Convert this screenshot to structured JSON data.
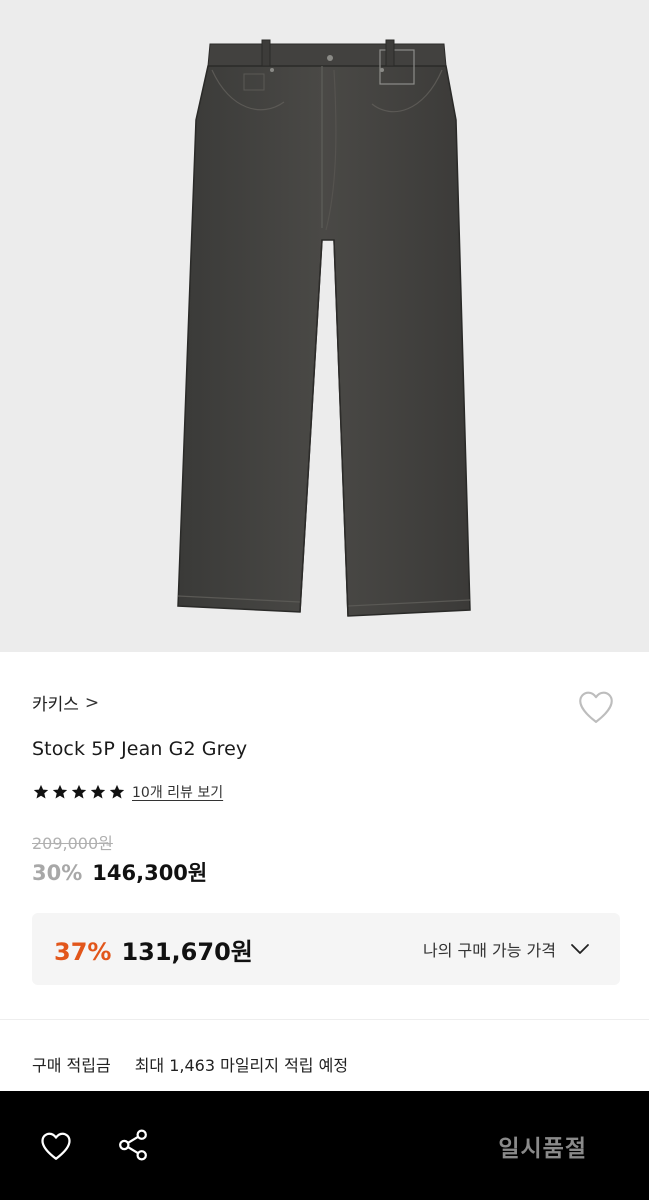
{
  "product": {
    "brand": "카키스",
    "brand_chevron": ">",
    "title": "Stock 5P Jean G2 Grey",
    "rating_stars": 5,
    "review_link": "10개 리뷰 보기",
    "original_price": "209,000원",
    "discount_rate": "30%",
    "sale_price": "146,300원",
    "image_icon": "jeans-photo"
  },
  "my_price": {
    "discount_rate": "37%",
    "amount": "131,670원",
    "label": "나의 구매 가능 가격"
  },
  "points": {
    "label": "구매 적립금",
    "value": "최대 1,463 마일리지 적립 예정"
  },
  "bottom_bar": {
    "status_label": "일시품절"
  },
  "colors": {
    "accent_orange": "#e2561b",
    "hero_bg": "#ececec",
    "bottom_bar_bg": "#000000"
  }
}
